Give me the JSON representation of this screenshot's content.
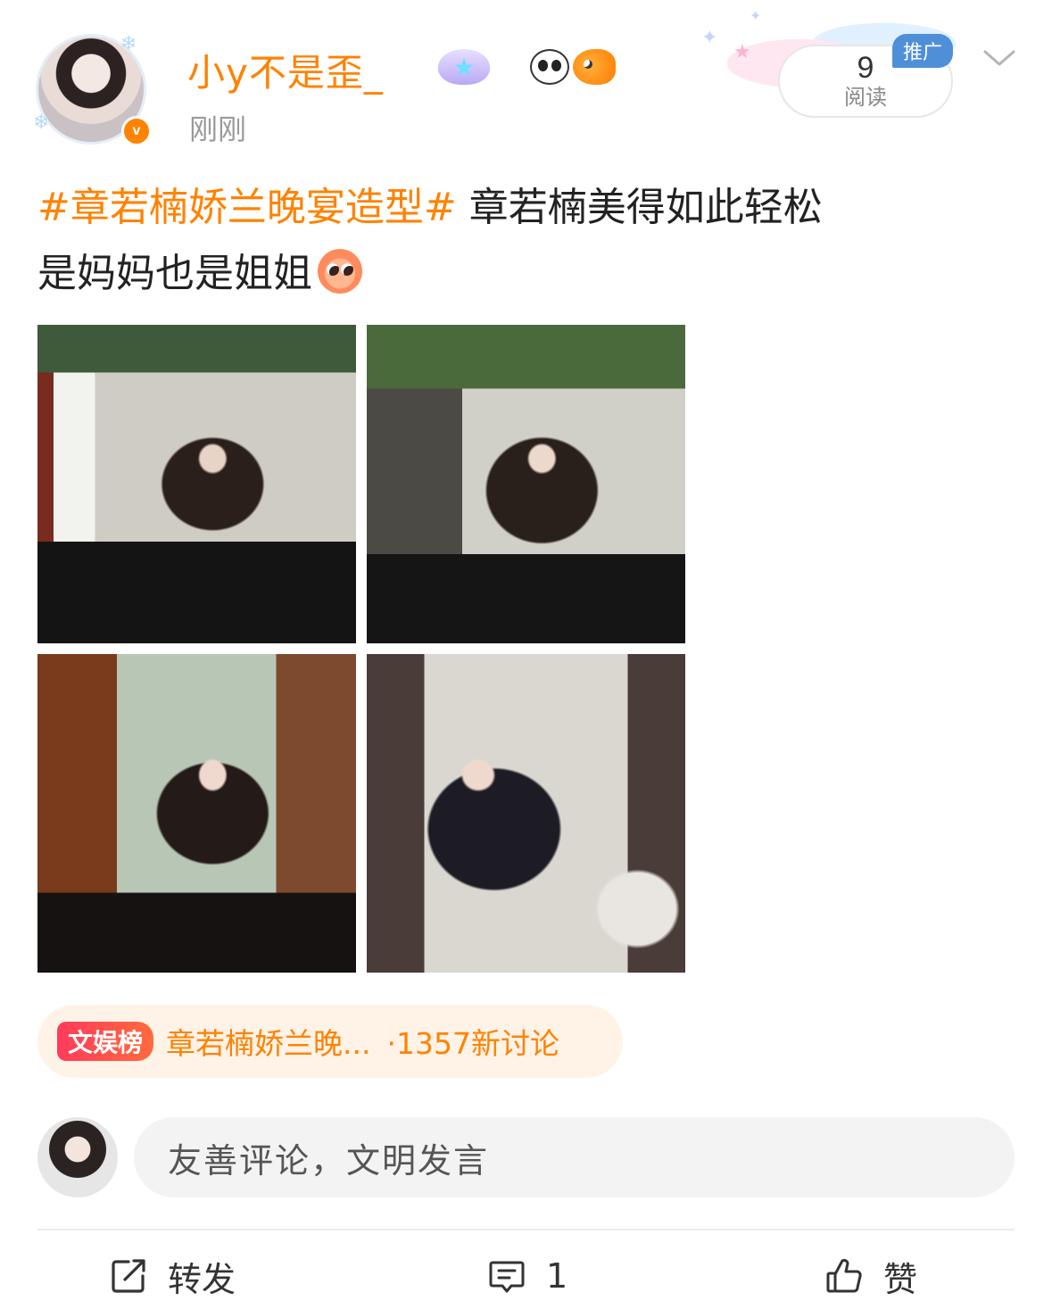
{
  "post": {
    "author": {
      "name": "小y不是歪_",
      "timestamp": "刚刚",
      "verified_icon": "verified-v-icon",
      "badges": [
        "star-wings-badge-icon",
        "panda-badge-icon",
        "goldfish-badge-icon"
      ]
    },
    "promo": {
      "tag": "推广",
      "read_count": "9",
      "read_label": "阅读"
    },
    "text": {
      "hashtag": "#章若楠娇兰晚宴造型#",
      "line1_rest": " 章若楠美得如此轻松",
      "line2": "是妈妈也是姐姐",
      "emoji": "pleading-face-emoji"
    },
    "photos_count": 4
  },
  "topic": {
    "badge": "文娱榜",
    "title": "章若楠娇兰晚...",
    "count": "·1357新讨论"
  },
  "comment": {
    "placeholder": "友善评论，文明发言"
  },
  "actions": {
    "repost": "转发",
    "comment_count": "1",
    "like": "赞"
  },
  "colors": {
    "accent": "#ff8200",
    "topic_bg": "#fff3e8",
    "promo_blue": "#4f8fd8",
    "input_bg": "#f3f3f3"
  }
}
